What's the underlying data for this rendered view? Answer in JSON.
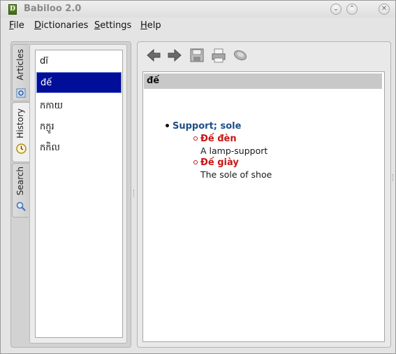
{
  "window": {
    "title": "Babiloo 2.0",
    "icon_letter": "D"
  },
  "menubar": {
    "items": [
      {
        "mnemonic": "F",
        "rest": "ile"
      },
      {
        "mnemonic": "D",
        "rest": "ictionaries"
      },
      {
        "mnemonic": "S",
        "rest": "ettings"
      },
      {
        "mnemonic": "H",
        "rest": "elp"
      }
    ]
  },
  "side_tabs": {
    "articles": "Articles",
    "history": "History",
    "search": "Search",
    "active": "history"
  },
  "word_list": {
    "items": [
      "dĩ",
      "đế",
      "កកាយ",
      "កក្ញូរ",
      "កកិល"
    ],
    "selected_index": 1
  },
  "toolbar": {
    "buttons": [
      "back-arrow-icon",
      "forward-arrow-icon",
      "save-icon",
      "print-icon",
      "speak-icon"
    ]
  },
  "article": {
    "headword": "đế",
    "sense": "Support; sole",
    "examples": [
      {
        "phrase": "Đế đèn",
        "translation": "A lamp-support"
      },
      {
        "phrase": "Đế giày",
        "translation": "The sole of shoe"
      }
    ]
  },
  "colors": {
    "selection": "#000e9a",
    "sense_text": "#1c4f87",
    "example_text": "#c91515"
  }
}
